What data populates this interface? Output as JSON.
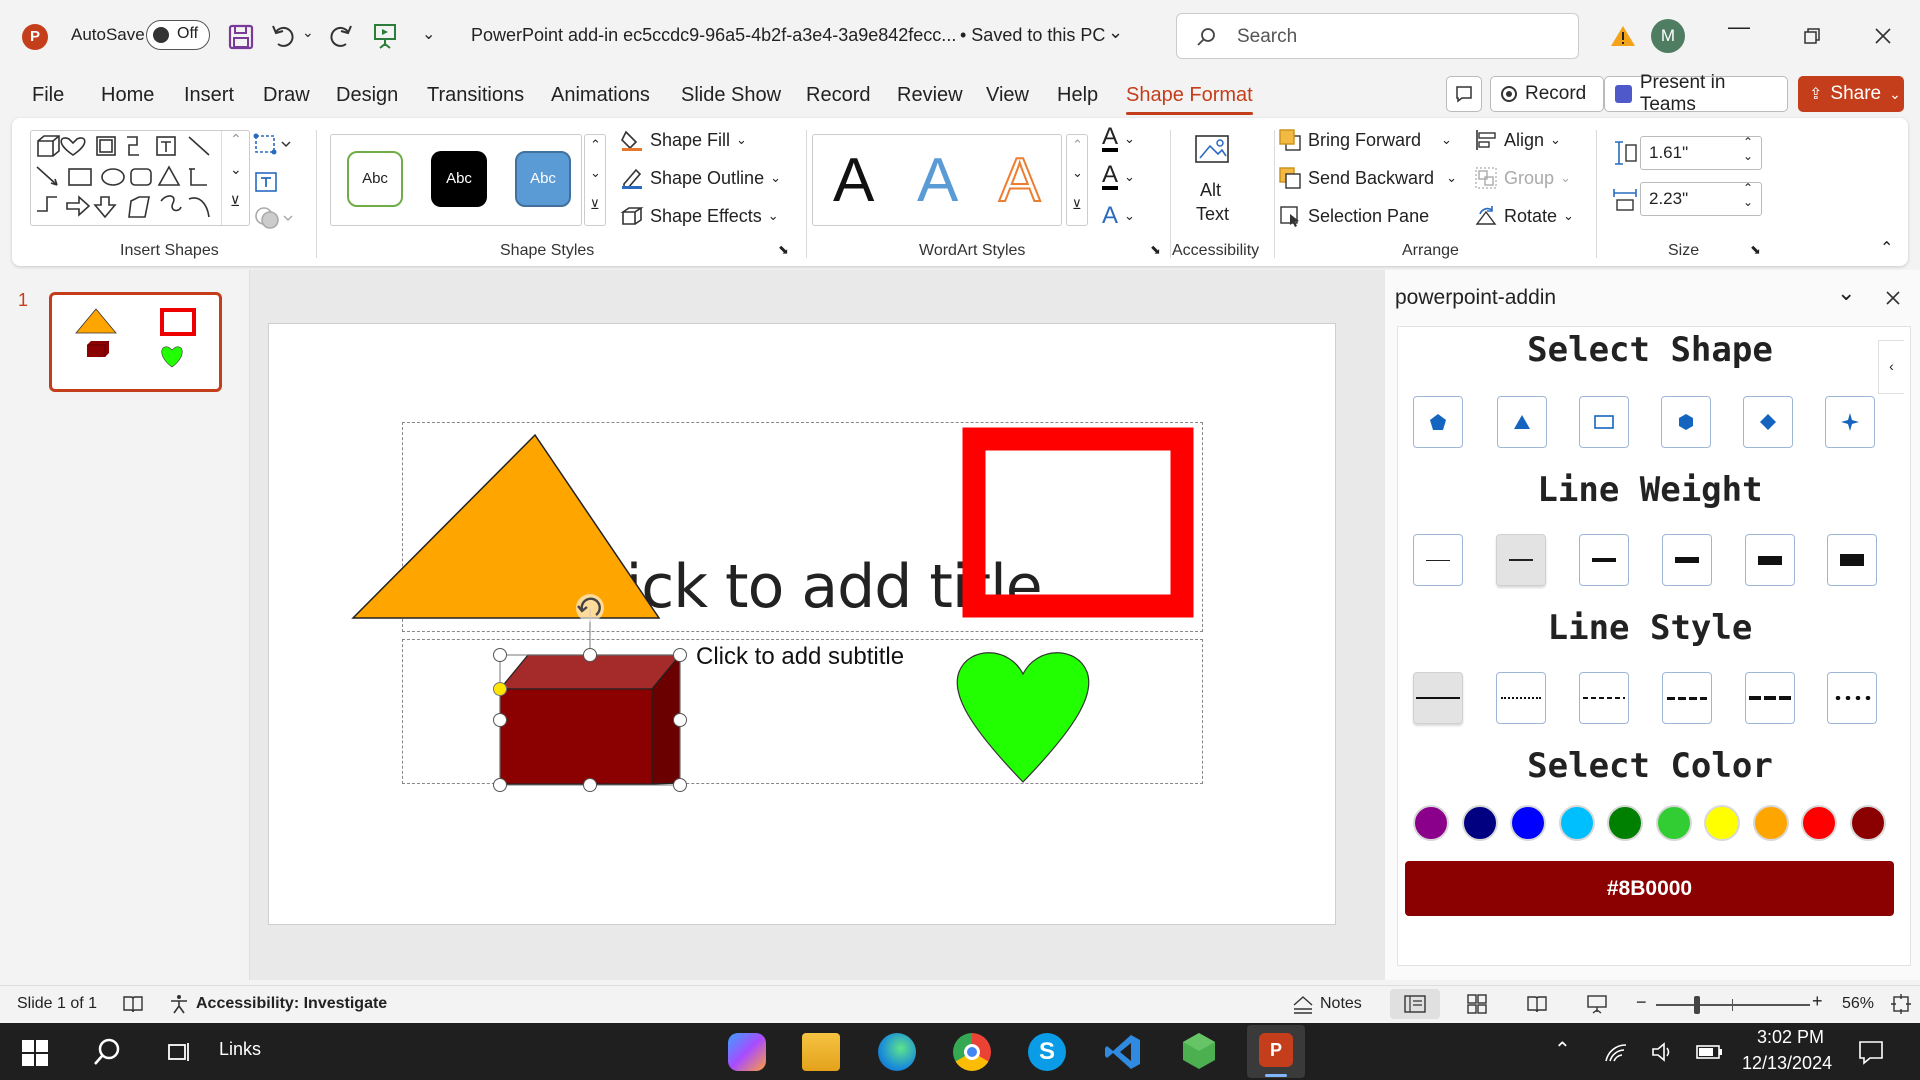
{
  "app": {
    "autosave_label": "AutoSave",
    "autosave_state": "Off",
    "doc_title": "PowerPoint add-in ec5ccdc9-96a5-4b2f-a3e4-3a9e842fecc...",
    "save_status": "• Saved to this PC",
    "search_placeholder": "Search",
    "avatar_initial": "M"
  },
  "tabs": [
    "File",
    "Home",
    "Insert",
    "Draw",
    "Design",
    "Transitions",
    "Animations",
    "Slide Show",
    "Record",
    "Review",
    "View",
    "Help",
    "Shape Format"
  ],
  "header_buttons": {
    "record": "Record",
    "present": "Present in Teams",
    "share": "Share"
  },
  "ribbon": {
    "groups": {
      "insert_shapes": "Insert Shapes",
      "shape_styles": "Shape Styles",
      "wordart_styles": "WordArt Styles",
      "accessibility": "Accessibility",
      "arrange": "Arrange",
      "size": "Size"
    },
    "style_samples": [
      "Abc",
      "Abc",
      "Abc"
    ],
    "shape_fill": "Shape Fill",
    "shape_outline": "Shape Outline",
    "shape_effects": "Shape Effects",
    "wordart_sample": "A",
    "alt_text_1": "Alt",
    "alt_text_2": "Text",
    "bring_forward": "Bring Forward",
    "send_backward": "Send Backward",
    "selection_pane": "Selection Pane",
    "align": "Align",
    "group": "Group",
    "rotate": "Rotate",
    "height": "1.61\"",
    "width": "2.23\""
  },
  "slides_pane": {
    "slide_number": "1"
  },
  "slide": {
    "title_placeholder": "Click to add title",
    "subtitle_placeholder": "Click to add subtitle"
  },
  "taskpane": {
    "title": "powerpoint-addin",
    "select_shape": "Select Shape",
    "line_weight": "Line Weight",
    "line_style": "Line Style",
    "select_color": "Select Color",
    "selected_color": "#8B0000",
    "colors": [
      "#8B008B",
      "#000080",
      "#0000FF",
      "#00BFFF",
      "#008000",
      "#32CD32",
      "#FFFF00",
      "#FFA500",
      "#FF0000",
      "#8B0000"
    ],
    "selected_line_weight_index": 1,
    "selected_line_style_index": 0
  },
  "status": {
    "slide_info": "Slide 1 of 1",
    "accessibility": "Accessibility: Investigate",
    "notes": "Notes",
    "zoom": "56%"
  },
  "taskbar": {
    "links_label": "Links",
    "time": "3:02 PM",
    "date": "12/13/2024"
  }
}
